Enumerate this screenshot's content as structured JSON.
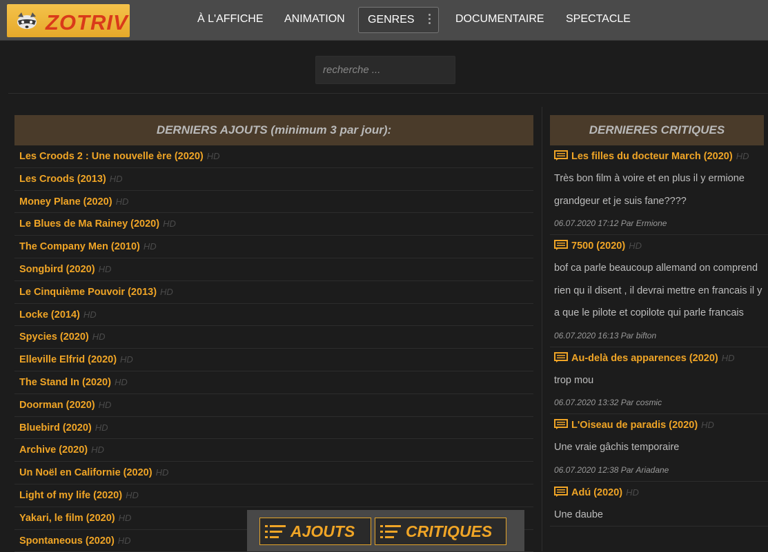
{
  "header": {
    "logo_text": "ZOTRIV",
    "nav": [
      {
        "label": "À L'AFFICHE"
      },
      {
        "label": "ANIMATION"
      },
      {
        "label": "GENRES"
      },
      {
        "label": "DOCUMENTAIRE"
      },
      {
        "label": "SPECTACLE"
      }
    ]
  },
  "search": {
    "placeholder": "recherche ..."
  },
  "latest": {
    "heading": "DERNIERS AJOUTS (minimum 3 par jour):",
    "items": [
      {
        "title": "Les Croods 2 : Une nouvelle ère (2020)",
        "badge": "HD"
      },
      {
        "title": "Les Croods (2013)",
        "badge": "HD"
      },
      {
        "title": "Money Plane (2020)",
        "badge": "HD"
      },
      {
        "title": "Le Blues de Ma Rainey (2020)",
        "badge": "HD"
      },
      {
        "title": "The Company Men (2010)",
        "badge": "HD"
      },
      {
        "title": "Songbird (2020)",
        "badge": "HD"
      },
      {
        "title": "Le Cinquième Pouvoir (2013)",
        "badge": "HD"
      },
      {
        "title": "Locke (2014)",
        "badge": "HD"
      },
      {
        "title": "Spycies (2020)",
        "badge": "HD"
      },
      {
        "title": "Elleville Elfrid (2020)",
        "badge": "HD"
      },
      {
        "title": "The Stand In (2020)",
        "badge": "HD"
      },
      {
        "title": "Doorman (2020)",
        "badge": "HD"
      },
      {
        "title": "Bluebird (2020)",
        "badge": "HD"
      },
      {
        "title": "Archive (2020)",
        "badge": "HD"
      },
      {
        "title": "Un Noël en Californie (2020)",
        "badge": "HD"
      },
      {
        "title": "Light of my life (2020)",
        "badge": "HD"
      },
      {
        "title": "Yakari, le film (2020)",
        "badge": "HD"
      },
      {
        "title": "Spontaneous (2020)",
        "badge": "HD"
      }
    ]
  },
  "reviews": {
    "heading": "DERNIERES CRITIQUES",
    "items": [
      {
        "title": "Les filles du docteur March (2020)",
        "badge": "HD",
        "text": "Très bon film à voire et en plus il y ermione grandgeur et je suis fane????",
        "meta": "06.07.2020 17:12 Par Ermione"
      },
      {
        "title": "7500 (2020)",
        "badge": "HD",
        "text": "bof ca parle beaucoup allemand on comprend rien qu il disent , il devrai mettre en francais il y a que le pilote et copilote qui parle francais",
        "meta": "06.07.2020 16:13 Par bifton"
      },
      {
        "title": "Au-delà des apparences (2020)",
        "badge": "HD",
        "text": "trop mou",
        "meta": "06.07.2020 13:32 Par cosmic"
      },
      {
        "title": "L'Oiseau de paradis (2020)",
        "badge": "HD",
        "text": "Une vraie gâchis temporaire",
        "meta": "06.07.2020 12:38 Par Ariadane"
      },
      {
        "title": "Adú (2020)",
        "badge": "HD",
        "text": "Une daube",
        "meta": ""
      }
    ]
  },
  "bottom": {
    "ajouts_label": "AJOUTS",
    "critiques_label": "CRITIQUES"
  },
  "colors": {
    "accent": "#f0a526",
    "header_bg": "#4a4a4a",
    "panel_header_bg": "#4a3b2a",
    "logo_bg": "#f4c24a",
    "logo_text": "#d93a1a"
  },
  "icons": {
    "logo": "raccoon-icon",
    "review": "comment-icon",
    "menu": "kebab-icon",
    "list": "list-icon"
  }
}
